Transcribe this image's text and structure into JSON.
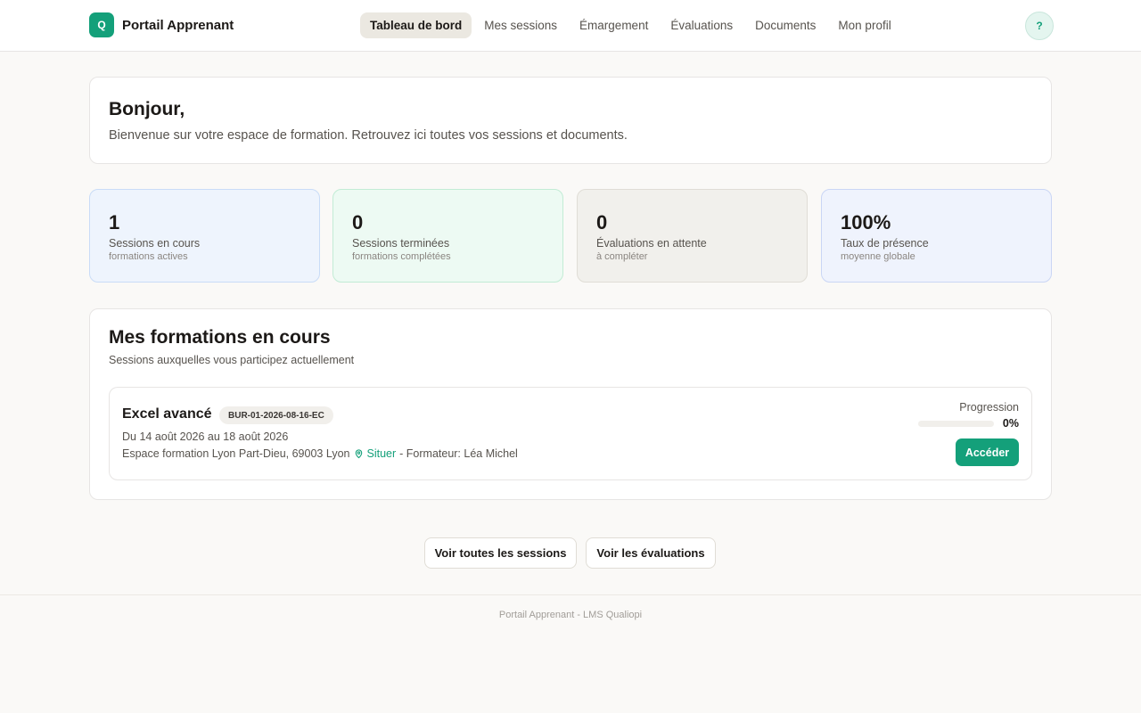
{
  "header": {
    "logo_letter": "Q",
    "brand": "Portail Apprenant",
    "nav": [
      {
        "label": "Tableau de bord",
        "active": true
      },
      {
        "label": "Mes sessions",
        "active": false
      },
      {
        "label": "Émargement",
        "active": false
      },
      {
        "label": "Évaluations",
        "active": false
      },
      {
        "label": "Documents",
        "active": false
      },
      {
        "label": "Mon profil",
        "active": false
      }
    ],
    "help_label": "?"
  },
  "welcome": {
    "title": "Bonjour,",
    "subtitle": "Bienvenue sur votre espace de formation. Retrouvez ici toutes vos sessions et documents."
  },
  "stats": [
    {
      "value": "1",
      "label": "Sessions en cours",
      "sub": "formations actives"
    },
    {
      "value": "0",
      "label": "Sessions terminées",
      "sub": "formations complétées"
    },
    {
      "value": "0",
      "label": "Évaluations en attente",
      "sub": "à compléter"
    },
    {
      "value": "100%",
      "label": "Taux de présence",
      "sub": "moyenne globale"
    }
  ],
  "formations": {
    "title": "Mes formations en cours",
    "subtitle": "Sessions auxquelles vous participez actuellement",
    "sessions": [
      {
        "title": "Excel avancé",
        "code": "BUR-01-2026-08-16-EC",
        "dates": "Du 14 août 2026 au 18 août 2026",
        "location": "Espace formation Lyon Part-Dieu, 69003 Lyon",
        "situer_label": "Situer",
        "trainer_text": "- Formateur: Léa Michel",
        "progress_label": "Progression",
        "progress_text": "0%",
        "progress_value": 0,
        "action_label": "Accéder"
      }
    ]
  },
  "actions": {
    "all_sessions": "Voir toutes les sessions",
    "evaluations": "Voir les évaluations"
  },
  "footer": {
    "text": "Portail Apprenant - LMS Qualiopi"
  },
  "colors": {
    "accent": "#14a07a",
    "background": "#faf9f7"
  },
  "icons": {
    "situer": "map-pin-icon"
  }
}
